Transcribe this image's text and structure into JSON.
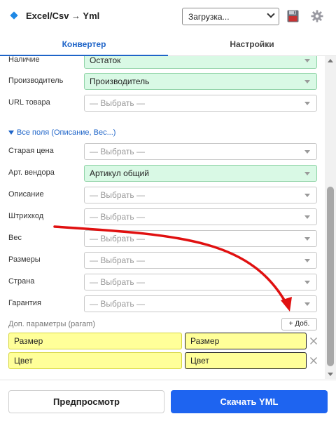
{
  "header": {
    "title": "Excel/Csv → Yml",
    "load_select": "Загрузка...",
    "accent": "#1e88e5"
  },
  "tabs": [
    {
      "label": "Конвертер",
      "active": true
    },
    {
      "label": "Настройки",
      "active": false
    }
  ],
  "fields_main": [
    {
      "label": "Наличие",
      "value": "Остаток",
      "filled": true
    },
    {
      "label": "Производитель",
      "value": "Производитель",
      "filled": true
    },
    {
      "label": "URL товара",
      "value": "— Выбрать —",
      "filled": false
    }
  ],
  "section_toggle": "Все поля (Описание, Вес...)",
  "fields_extra": [
    {
      "label": "Старая цена",
      "value": "— Выбрать —",
      "filled": false
    },
    {
      "label": "Арт. вендора",
      "value": "Артикул общий",
      "filled": true
    },
    {
      "label": "Описание",
      "value": "— Выбрать —",
      "filled": false
    },
    {
      "label": "Штрихкод",
      "value": "— Выбрать —",
      "filled": false
    },
    {
      "label": "Вес",
      "value": "— Выбрать —",
      "filled": false
    },
    {
      "label": "Размеры",
      "value": "— Выбрать —",
      "filled": false
    },
    {
      "label": "Страна",
      "value": "— Выбрать —",
      "filled": false
    },
    {
      "label": "Гарантия",
      "value": "— Выбрать —",
      "filled": false
    }
  ],
  "params": {
    "label": "Доп. параметры (param)",
    "add_label": "+ Доб.",
    "rows": [
      {
        "name": "Размер",
        "value": "Размер"
      },
      {
        "name": "Цвет",
        "value": "Цвет"
      }
    ]
  },
  "footer": {
    "preview_label": "Предпросмотр",
    "download_label": "Скачать YML"
  },
  "colors": {
    "primary": "#1e64f0",
    "filled_bg": "#d9f9e5",
    "highlight": "#ffff99",
    "annotation": "#e01010"
  }
}
